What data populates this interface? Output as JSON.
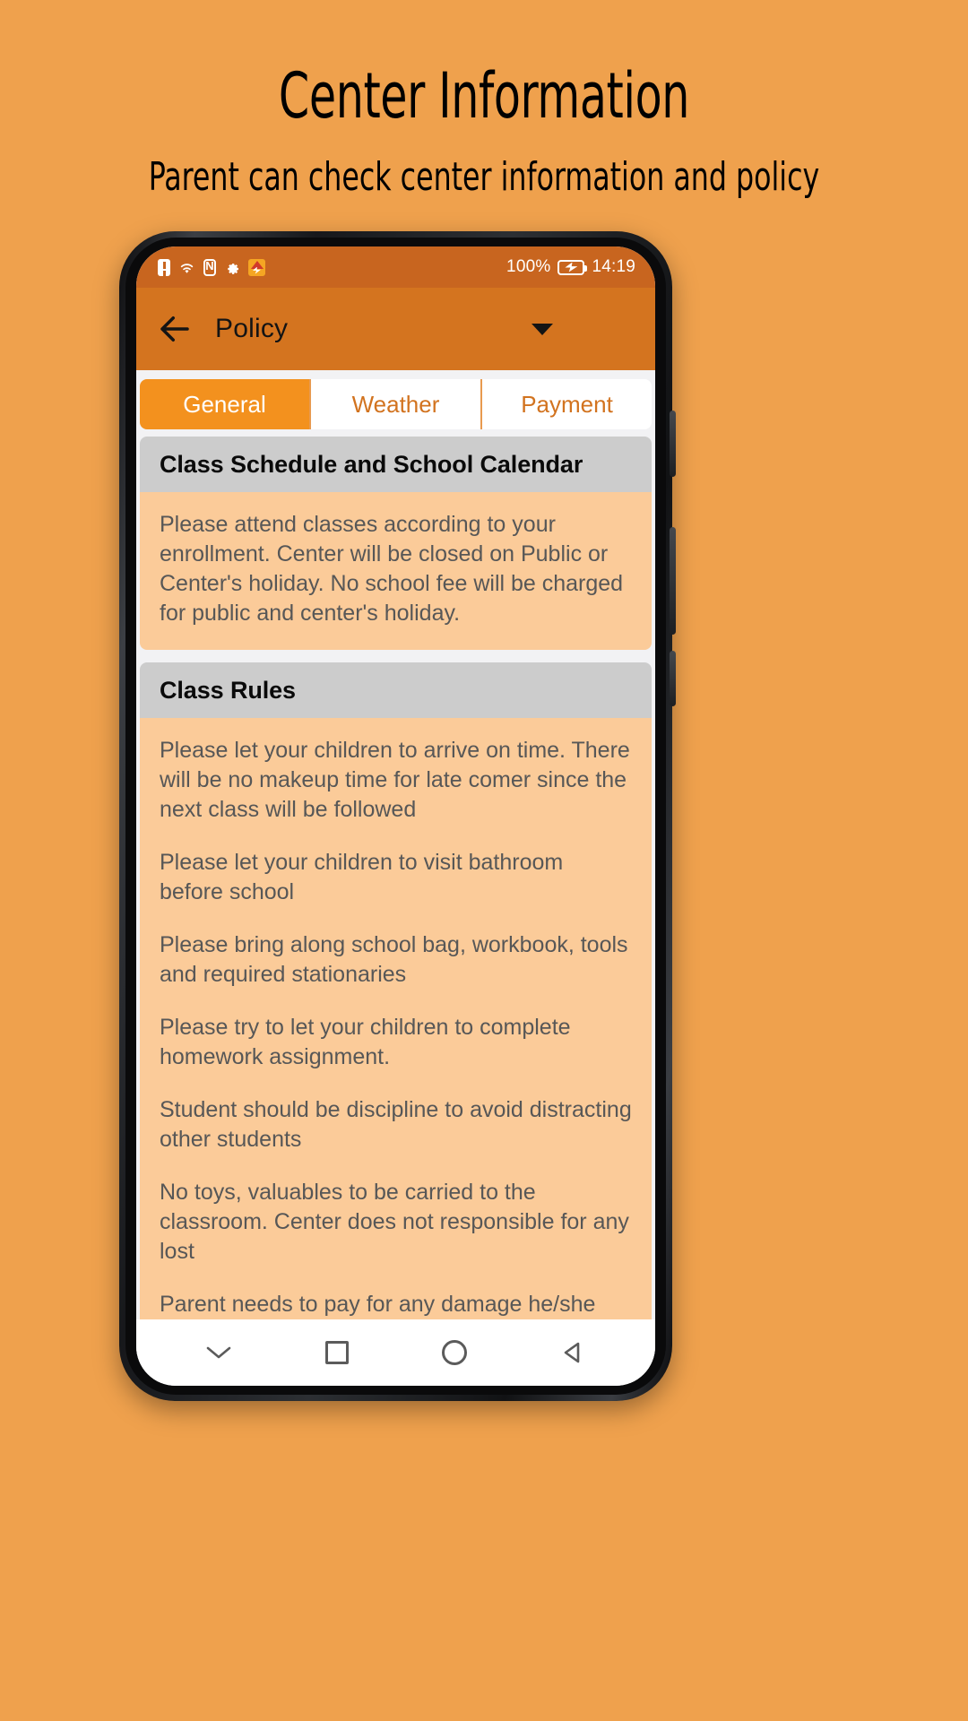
{
  "promo": {
    "title": "Center Information",
    "subtitle": "Parent can check center information and policy"
  },
  "colors": {
    "page_background": "#efa14d",
    "statusbar": "#c8651f",
    "appbar": "#d4741f",
    "tab_active": "#f3911e",
    "tab_text": "#d2731f",
    "card_head": "#cccccc",
    "card_body": "#fbcb99",
    "body_text": "#575757"
  },
  "statusbar": {
    "icons": [
      "alert-icon",
      "wifi-icon",
      "nfc-icon",
      "gear-icon",
      "app-icon"
    ],
    "battery_percent": "100%",
    "battery_icon": "battery-charging-icon",
    "time": "14:19"
  },
  "appbar": {
    "back_icon": "back-arrow-icon",
    "title": "Policy",
    "dropdown_icon": "chevron-down-icon"
  },
  "tabs": [
    {
      "label": "General",
      "active": true
    },
    {
      "label": "Weather",
      "active": false
    },
    {
      "label": "Payment",
      "active": false
    }
  ],
  "cards": [
    {
      "title": "Class Schedule and School Calendar",
      "paragraphs": [
        "Please attend classes according to your enrollment. Center will be closed on Public or Center's holiday.  No school fee will be charged for public and center's holiday."
      ]
    },
    {
      "title": "Class Rules",
      "paragraphs": [
        "Please let your children to arrive on time. There will be no makeup time for late comer since the next class will be followed",
        "Please let your children to visit bathroom before school",
        "Please bring along school bag, workbook, tools and required stationaries",
        "Please try to let your children to complete homework assignment.",
        "Student should be discipline to avoid distracting other students",
        "No toys, valuables to be carried to the classroom.  Center does not responsible for any lost",
        "Parent needs to pay for any damage he/she made on any stationary, devices, booklet or"
      ]
    }
  ],
  "navbar": {
    "items": [
      "chevron-down-nav-icon",
      "recents-square-icon",
      "home-circle-icon",
      "back-triangle-icon"
    ]
  }
}
